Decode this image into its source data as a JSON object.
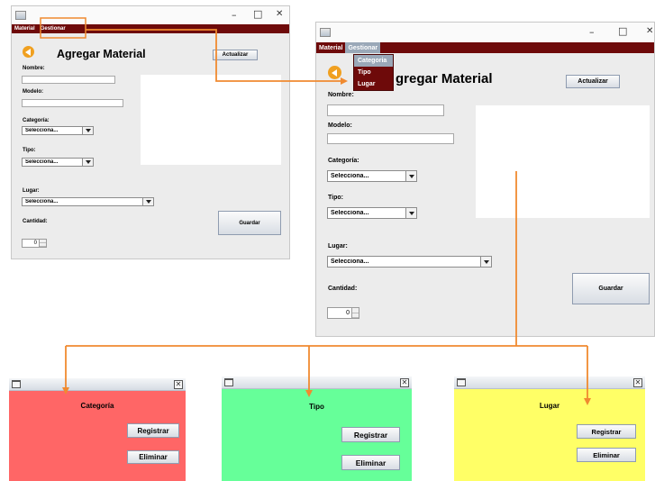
{
  "small_window": {
    "menu": [
      "Material",
      "Gestionar"
    ],
    "window_controls": [
      "–",
      "□",
      "✕"
    ],
    "heading": "Agregar Material",
    "update_button": "Actualizar",
    "labels": {
      "name": "Nombre:",
      "model": "Modelo:",
      "category": "Categoría:",
      "type": "Tipo:",
      "place": "Lugar:",
      "quantity": "Cantidad:"
    },
    "selects": {
      "category": "Selecciona...",
      "type": "Selecciona...",
      "place": "Selecciona..."
    },
    "save_button": "Guardar",
    "quantity_value": "0"
  },
  "large_window": {
    "menu": [
      "Material",
      "Gestionar"
    ],
    "window_controls": [
      "–",
      "□",
      "✕"
    ],
    "dropdown_items": [
      "Categoria",
      "Tipo",
      "Lugar"
    ],
    "heading": "gregar Material",
    "update_button": "Actualizar",
    "labels": {
      "name": "Nombre:",
      "model": "Modelo:",
      "category": "Categoría:",
      "type": "Tipo:",
      "place": "Lugar:",
      "quantity": "Cantidad:"
    },
    "selects": {
      "category": "Selecciona...",
      "type": "Selecciona...",
      "place": "Selecciona..."
    },
    "save_button": "Guardar",
    "quantity_value": "0"
  },
  "dialogs": [
    {
      "title": "Categoría",
      "register_button": "Registrar",
      "delete_button": "Eliminar",
      "color": "#ff6666"
    },
    {
      "title": "Tipo",
      "register_button": "Registrar",
      "delete_button": "Eliminar",
      "color": "#66ff99"
    },
    {
      "title": "Lugar",
      "register_button": "Registrar",
      "delete_button": "Eliminar",
      "color": "#ffff66"
    }
  ],
  "colors": {
    "menubar": "#6e0a0a",
    "arrow": "#f08a30",
    "highlight": "#9aa8b8"
  }
}
